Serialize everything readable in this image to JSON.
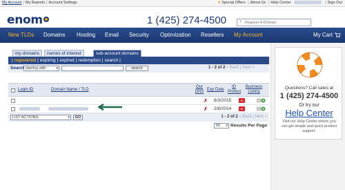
{
  "topbar": {
    "left_links": [
      "My Account",
      "My Reports",
      "Account Settings"
    ],
    "special_offers": "Special Offers",
    "about_us": "About Us",
    "help_center": "Help Center",
    "sign_out": "Sign Out"
  },
  "header": {
    "logo_text": "enom",
    "phone": "1 (425) 274-4500",
    "search_placeholder": "Register A Domain"
  },
  "nav": {
    "items": [
      "New TLDs",
      "Domains",
      "Hosting",
      "Email",
      "Security",
      "Optimization",
      "Resellers",
      "My Account"
    ],
    "cart_label": "My Cart"
  },
  "tabs": [
    "my domains",
    "names of interest",
    "sub-account domains"
  ],
  "active_tab": "sub-account domains",
  "subnav": {
    "items": [
      "registered",
      "expiring",
      "expired",
      "redemption",
      "search"
    ],
    "active": "registered"
  },
  "search": {
    "label": "Search",
    "mode": "starting with",
    "button": "search"
  },
  "pager": {
    "count": "1 - 2 of 2",
    "first": "«",
    "back": "Back",
    "next": "Next",
    "last": "»"
  },
  "table": {
    "headers": {
      "login_id": "Login ID",
      "domain_name": "Domain Name / TLD",
      "our_dns": "Our DNS",
      "exp_date": "Exp Date",
      "id_protect": "ID Protect",
      "business_listing": "Business Listing"
    },
    "rows": [
      {
        "exp_date": "6/3/2015"
      },
      {
        "exp_date": "2/8/2014"
      }
    ]
  },
  "actions": {
    "select_label": "LIST ACTIONS:",
    "go": "GO"
  },
  "per_page": {
    "value": "50",
    "label": "Results Per Page"
  },
  "sidebar": {
    "question": "Questions? Call sales at",
    "phone": "1 (425) 274-4500",
    "try_text": "Or try our",
    "help_center": "Help Center",
    "description": "Visit our Help Center where you can get simple and quick product support."
  },
  "colors": {
    "nav_bg": "#1e3c78",
    "accent": "#f6b22a",
    "link": "#1f4fb0",
    "alert_red": "#d8262c"
  }
}
